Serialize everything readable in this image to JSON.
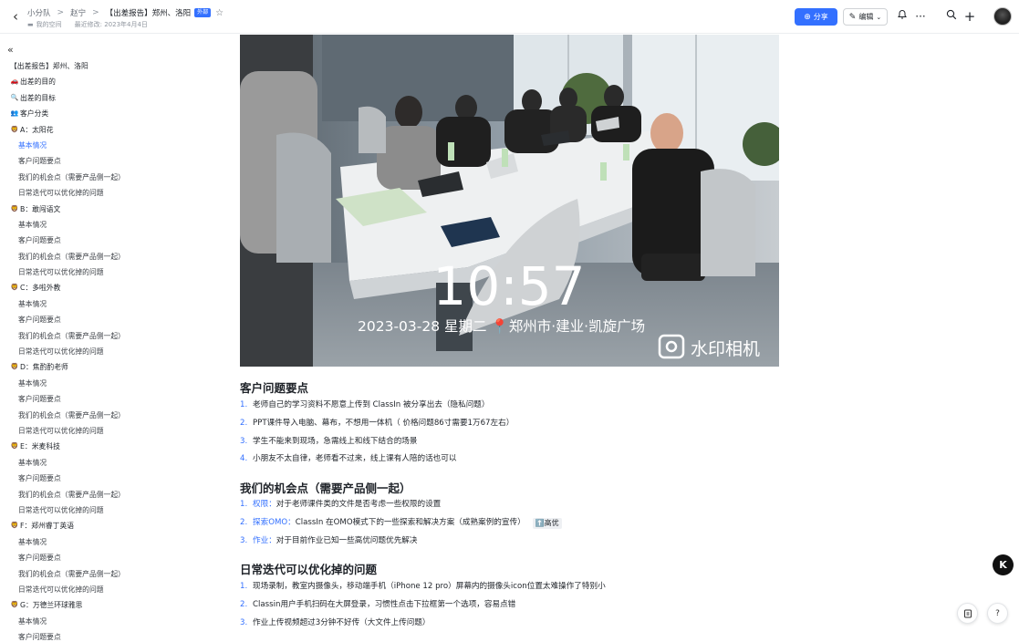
{
  "header": {
    "breadcrumbs": [
      "小分队",
      "赵宁",
      "【出差报告】郑州、洛阳"
    ],
    "tag": "外部",
    "location": "我的空间",
    "last_modified": "最近修改: 2023年4月4日",
    "share_label": "分享",
    "edit_label": "编辑"
  },
  "outline": {
    "items": [
      {
        "text": "【出差报告】郑州、洛阳",
        "level": 1,
        "emoji": ""
      },
      {
        "text": "出差的目的",
        "level": 1,
        "emoji": "🚗"
      },
      {
        "text": "出差的目标",
        "level": 1,
        "emoji": "🔍"
      },
      {
        "text": "客户分类",
        "level": 1,
        "emoji": "👥"
      },
      {
        "text": "A：太阳花",
        "level": 1,
        "emoji": "🦁"
      },
      {
        "text": "基本情况",
        "level": 2,
        "emoji": "",
        "active": true
      },
      {
        "text": "客户问题要点",
        "level": 2,
        "emoji": ""
      },
      {
        "text": "我们的机会点（需要产品侧一起）",
        "level": 2,
        "emoji": ""
      },
      {
        "text": "日常迭代可以优化掉的问题",
        "level": 2,
        "emoji": ""
      },
      {
        "text": "B：敢闯语文",
        "level": 1,
        "emoji": "🦁"
      },
      {
        "text": "基本情况",
        "level": 2,
        "emoji": ""
      },
      {
        "text": "客户问题要点",
        "level": 2,
        "emoji": ""
      },
      {
        "text": "我们的机会点（需要产品侧一起）",
        "level": 2,
        "emoji": ""
      },
      {
        "text": "日常迭代可以优化掉的问题",
        "level": 2,
        "emoji": ""
      },
      {
        "text": "C：多啦外教",
        "level": 1,
        "emoji": "🦁"
      },
      {
        "text": "基本情况",
        "level": 2,
        "emoji": ""
      },
      {
        "text": "客户问题要点",
        "level": 2,
        "emoji": ""
      },
      {
        "text": "我们的机会点（需要产品侧一起）",
        "level": 2,
        "emoji": ""
      },
      {
        "text": "日常迭代可以优化掉的问题",
        "level": 2,
        "emoji": ""
      },
      {
        "text": "D：焦酌酌老师",
        "level": 1,
        "emoji": "🦁"
      },
      {
        "text": "基本情况",
        "level": 2,
        "emoji": ""
      },
      {
        "text": "客户问题要点",
        "level": 2,
        "emoji": ""
      },
      {
        "text": "我们的机会点（需要产品侧一起）",
        "level": 2,
        "emoji": ""
      },
      {
        "text": "日常迭代可以优化掉的问题",
        "level": 2,
        "emoji": ""
      },
      {
        "text": "E：米麦科技",
        "level": 1,
        "emoji": "🦁"
      },
      {
        "text": "基本情况",
        "level": 2,
        "emoji": ""
      },
      {
        "text": "客户问题要点",
        "level": 2,
        "emoji": ""
      },
      {
        "text": "我们的机会点（需要产品侧一起）",
        "level": 2,
        "emoji": ""
      },
      {
        "text": "日常迭代可以优化掉的问题",
        "level": 2,
        "emoji": ""
      },
      {
        "text": "F：郑州睿丁英语",
        "level": 1,
        "emoji": "🦁"
      },
      {
        "text": "基本情况",
        "level": 2,
        "emoji": ""
      },
      {
        "text": "客户问题要点",
        "level": 2,
        "emoji": ""
      },
      {
        "text": "我们的机会点（需要产品侧一起）",
        "level": 2,
        "emoji": ""
      },
      {
        "text": "日常迭代可以优化掉的问题",
        "level": 2,
        "emoji": ""
      },
      {
        "text": "G：万德兰环球雅思",
        "level": 1,
        "emoji": "🦁"
      },
      {
        "text": "基本情况",
        "level": 2,
        "emoji": ""
      },
      {
        "text": "客户问题要点",
        "level": 2,
        "emoji": ""
      }
    ]
  },
  "photo": {
    "time": "10:57",
    "date_location": "2023-03-28  星期二 📍郑州市·建业·凯旋广场",
    "watermark_app": "水印相机"
  },
  "sections": {
    "problems": {
      "heading": "客户问题要点",
      "items": [
        {
          "num": "1.",
          "text": "老师自己的学习资料不愿意上传到 ClassIn 被分享出去（隐私问题）"
        },
        {
          "num": "2.",
          "text": "PPT课件导入电脑、幕布，不想用一体机（ 价格问题86寸需要1万67左右）"
        },
        {
          "num": "3.",
          "text": "学生不能来到现场，急需线上和线下结合的场景"
        },
        {
          "num": "4.",
          "text": "小朋友不太自律，老师看不过来，线上课有人陪的话也可以"
        }
      ]
    },
    "opportunities": {
      "heading": "我们的机会点（需要产品侧一起）",
      "items": [
        {
          "num": "1.",
          "keyword": "权限：",
          "text": "对于老师课件类的文件是否考虑一些权限的设置",
          "pill": ""
        },
        {
          "num": "2.",
          "keyword": "探索OMO：",
          "text": "ClassIn 在OMO模式下的一些探索和解决方案（成熟案例的宣传）",
          "pill": "⬆️高优"
        },
        {
          "num": "3.",
          "keyword": "作业：",
          "text": "对于目前作业已知一些高优问题优先解决",
          "pill": ""
        }
      ]
    },
    "iterations": {
      "heading": "日常迭代可以优化掉的问题",
      "items": [
        {
          "num": "1.",
          "text": "现场录制，教室内摄像头，移动端手机（iPhone 12 pro）屏幕内的摄像头icon位置太难操作了特别小"
        },
        {
          "num": "2.",
          "text": "Classin用户手机扫码在大屏登录，习惯性点击下拉框第一个选项，容易点错"
        },
        {
          "num": "3.",
          "text": "作业上传视频超过3分钟不好传（大文件上传问题）"
        }
      ]
    }
  },
  "floating": {
    "assistant_label": "K"
  },
  "colors": {
    "accent": "#3370ff",
    "text": "#1f2329",
    "muted": "#646a73"
  }
}
